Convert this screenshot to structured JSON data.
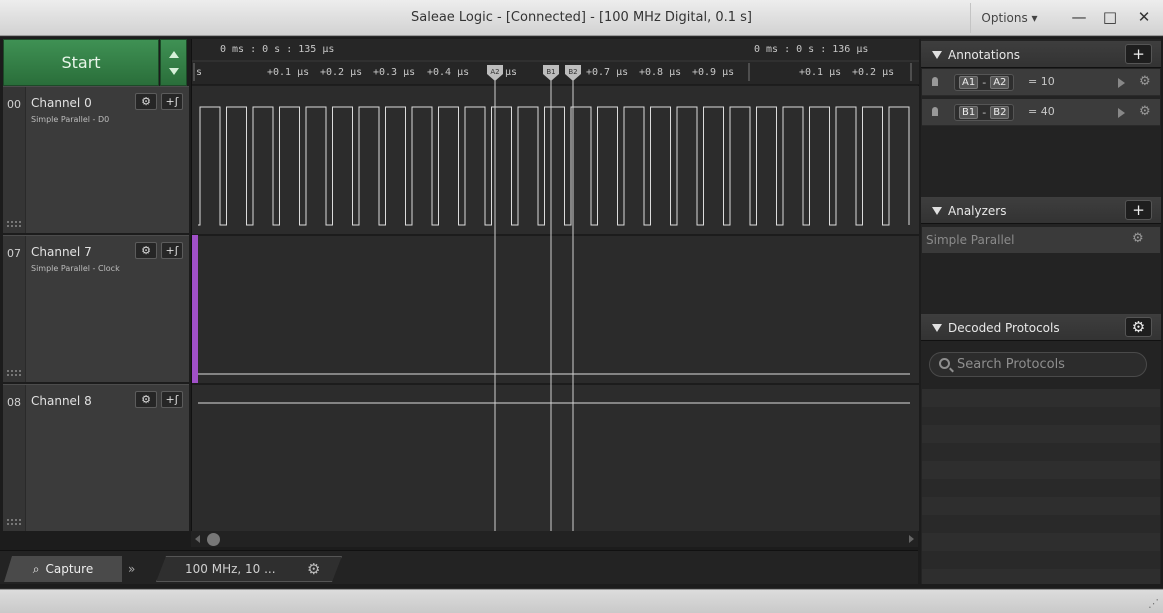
{
  "window": {
    "title": "Saleae Logic - [Connected] - [100 MHz Digital, 0.1 s]",
    "options_label": "Options ▾",
    "minimize": "—",
    "maximize": "□",
    "close": "✕"
  },
  "capture": {
    "start_label": "Start"
  },
  "channels": [
    {
      "num": "00",
      "name": "Channel 0",
      "sub": "Simple Parallel - D0",
      "add_label": "+ʃ"
    },
    {
      "num": "07",
      "name": "Channel 7",
      "sub": "Simple Parallel - Clock",
      "add_label": "+ʃ"
    },
    {
      "num": "08",
      "name": "Channel 8",
      "sub": "",
      "add_label": "+ʃ"
    }
  ],
  "ruler": {
    "time_labels": [
      "0 ms : 0 s : 135 μs",
      "0 ms : 0 s : 136 μs"
    ],
    "ticks": [
      "s",
      "+0.1 μs",
      "+0.2 μs",
      "+0.3 μs",
      "+0.4 μs",
      "μs",
      "+0.7 μs",
      "+0.8 μs",
      "+0.9 μs",
      "+0.1 μs",
      "+0.2 μs"
    ],
    "markers": [
      "A2",
      "B1",
      "B2"
    ]
  },
  "bottom": {
    "capture_tab": "Capture",
    "chevron": "»",
    "rate_tab": "100 MHz, 10 ..."
  },
  "annotations": {
    "title": "Annotations",
    "add_label": "+",
    "items": [
      {
        "from": "A1",
        "to": "A2",
        "dash": "-",
        "value": "= 10"
      },
      {
        "from": "B1",
        "to": "B2",
        "dash": "-",
        "value": "= 40"
      }
    ]
  },
  "analyzers": {
    "title": "Analyzers",
    "add_label": "+",
    "items": [
      "Simple Parallel"
    ]
  },
  "decoded": {
    "title": "Decoded Protocols",
    "search_placeholder": "Search Protocols"
  },
  "colors": {
    "start_green": "#2f7a41",
    "clock_marker": "#a050c8",
    "wave": "#dcdcdc",
    "panel_bg": "#232323"
  }
}
